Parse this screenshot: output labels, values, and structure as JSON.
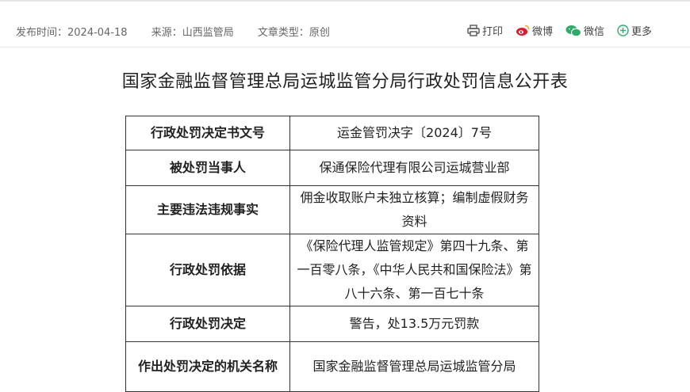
{
  "meta": {
    "publish_time": "发布时间：2024-04-18",
    "source": "来源：山西监管局",
    "article_type": "文章类型：原创"
  },
  "share": {
    "print": "打印",
    "weibo": "微博",
    "wechat": "微信",
    "more": "更多"
  },
  "colors": {
    "weibo": "#e6162d",
    "wechat": "#2aae67",
    "more": "#2aae67",
    "print": "#555555"
  },
  "title": "国家金融监督管理总局运城监管分局行政处罚信息公开表",
  "table": {
    "rows": [
      {
        "label": "行政处罚决定书文号",
        "value": "运金管罚决字〔2024〕7号"
      },
      {
        "label": "被处罚当事人",
        "value": "保通保险代理有限公司运城营业部"
      },
      {
        "label": "主要违法违规事实",
        "value": "佣金收取账户未独立核算；编制虚假财务资料"
      },
      {
        "label": "行政处罚依据",
        "value": "《保险代理人监管规定》第四十九条、第一百零八条，《中华人民共和国保险法》第八十六条、第一百七十条"
      },
      {
        "label": "行政处罚决定",
        "value": "警告，处13.5万元罚款"
      },
      {
        "label": "作出处罚决定的机关名称",
        "value": "国家金融监督管理总局运城监管分局"
      }
    ]
  }
}
